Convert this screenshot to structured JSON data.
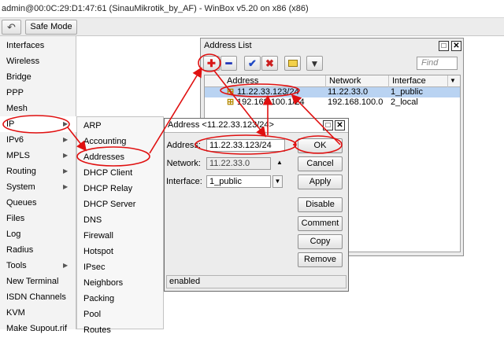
{
  "window": {
    "title": "admin@00:0C:29:D1:47:61 (SinauMikrotik_by_AF) - WinBox v5.20 on x86 (x86)"
  },
  "toolbar": {
    "safe_mode_label": "Safe Mode"
  },
  "sidebar": {
    "items": [
      {
        "label": "Interfaces",
        "arrow": ""
      },
      {
        "label": "Wireless",
        "arrow": ""
      },
      {
        "label": "Bridge",
        "arrow": ""
      },
      {
        "label": "PPP",
        "arrow": ""
      },
      {
        "label": "Mesh",
        "arrow": ""
      },
      {
        "label": "IP",
        "arrow": "▶"
      },
      {
        "label": "IPv6",
        "arrow": "▶"
      },
      {
        "label": "MPLS",
        "arrow": "▶"
      },
      {
        "label": "Routing",
        "arrow": "▶"
      },
      {
        "label": "System",
        "arrow": "▶"
      },
      {
        "label": "Queues",
        "arrow": ""
      },
      {
        "label": "Files",
        "arrow": ""
      },
      {
        "label": "Log",
        "arrow": ""
      },
      {
        "label": "Radius",
        "arrow": ""
      },
      {
        "label": "Tools",
        "arrow": "▶"
      },
      {
        "label": "New Terminal",
        "arrow": ""
      },
      {
        "label": "ISDN Channels",
        "arrow": ""
      },
      {
        "label": "KVM",
        "arrow": ""
      },
      {
        "label": "Make Supout.rif",
        "arrow": ""
      }
    ]
  },
  "ip_submenu": {
    "items": [
      "ARP",
      "Accounting",
      "Addresses",
      "DHCP Client",
      "DHCP Relay",
      "DHCP Server",
      "DNS",
      "Firewall",
      "Hotspot",
      "IPsec",
      "Neighbors",
      "Packing",
      "Pool",
      "Routes"
    ]
  },
  "address_list": {
    "title": "Address List",
    "find_placeholder": "Find",
    "columns": [
      "Address",
      "Network",
      "Interface"
    ],
    "rows": [
      {
        "address": "11.22.33.123/24",
        "network": "11.22.33.0",
        "interface": "1_public"
      },
      {
        "address": "192.168.100.1/24",
        "network": "192.168.100.0",
        "interface": "2_local"
      }
    ]
  },
  "dialog": {
    "title": "Address <11.22.33.123/24>",
    "address_label": "Address:",
    "address_value": "11.22.33.123/24",
    "network_label": "Network:",
    "network_value": "11.22.33.0",
    "interface_label": "Interface:",
    "interface_value": "1_public",
    "buttons": {
      "ok": "OK",
      "cancel": "Cancel",
      "apply": "Apply",
      "disable": "Disable",
      "comment": "Comment",
      "copy": "Copy",
      "remove": "Remove"
    },
    "status": "enabled"
  },
  "colors": {
    "annotation": "#e01010",
    "selection": "#b9d3f2",
    "add": "#d81818",
    "remove": "#1d33b8",
    "enable": "#1f49c4"
  }
}
